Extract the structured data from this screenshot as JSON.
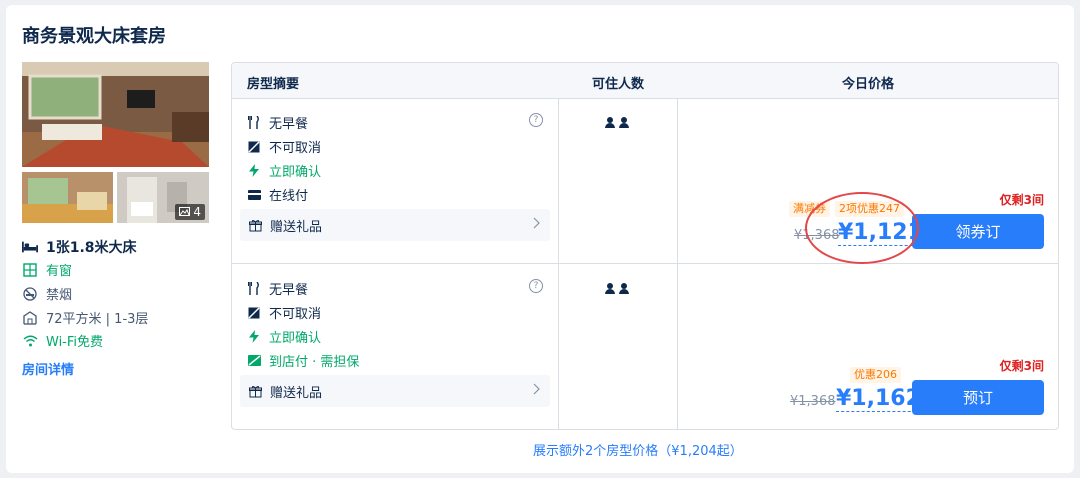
{
  "room": {
    "title": "商务景观大床套房",
    "photo_count": "4",
    "features": {
      "bed": "1张1.8米大床",
      "window": "有窗",
      "smoking": "禁烟",
      "area_floor": "72平方米 | 1-3层",
      "wifi": "Wi-Fi免费"
    },
    "details_link": "房间详情"
  },
  "table": {
    "headers": [
      "房型摘要",
      "可住人数",
      "今日价格"
    ],
    "rows": [
      {
        "policies": [
          {
            "icon": "meal-icon",
            "text": "无早餐",
            "green": false
          },
          {
            "icon": "no-cancel-icon",
            "text": "不可取消",
            "green": false
          },
          {
            "icon": "bolt-icon",
            "text": "立即确认",
            "green": true
          },
          {
            "icon": "card-icon",
            "text": "在线付",
            "green": false
          }
        ],
        "gift": "赠送礼品",
        "remaining": "仅剩3间",
        "promo_a": "满减券",
        "promo_b": "2项优惠247",
        "original_price": "¥1,368",
        "price": "¥1,121",
        "button": "领券订"
      },
      {
        "policies": [
          {
            "icon": "meal-icon",
            "text": "无早餐",
            "green": false
          },
          {
            "icon": "no-cancel-icon",
            "text": "不可取消",
            "green": false
          },
          {
            "icon": "bolt-icon",
            "text": "立即确认",
            "green": true
          },
          {
            "icon": "pay-at-hotel-icon",
            "text": "到店付 · 需担保",
            "green": true
          }
        ],
        "gift": "赠送礼品",
        "remaining": "仅剩3间",
        "promo": "优惠206",
        "original_price": "¥1,368",
        "price": "¥1,162",
        "button": "预订"
      }
    ]
  },
  "more_link": "展示额外2个房型价格（¥1,204起）",
  "colors": {
    "accent": "#287dfa",
    "green": "#00a96b",
    "alert": "#e02121",
    "promo": "#ff7700"
  }
}
